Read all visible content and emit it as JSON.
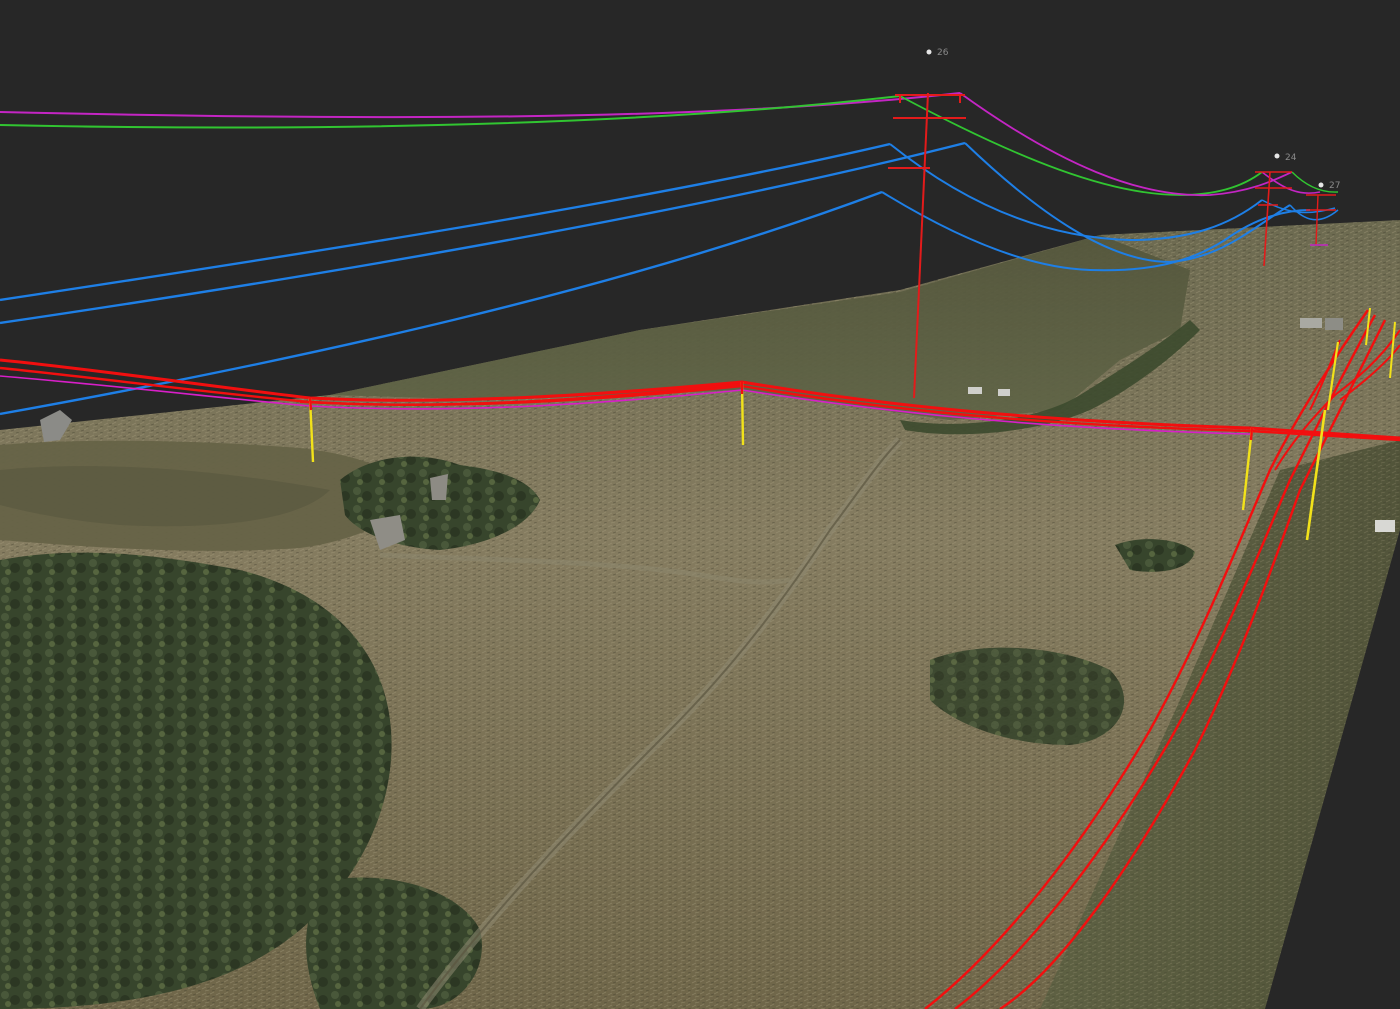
{
  "viewport": {
    "background_color": "#272727",
    "terrain_colors": {
      "grass_light": "#8d8466",
      "grass_mid": "#6f6a50",
      "grass_dark": "#4f4d38",
      "vegetation_dark": "#2f3a24",
      "paddock_green": "#5a5c40"
    }
  },
  "wire_colors": {
    "transmission_upper": "#c425c4",
    "transmission_green": "#31c531",
    "transmission_blue": "#1e7fe6",
    "distribution": "#f20f0f",
    "pole": "#f2e21a",
    "tower": "#e31b1b"
  },
  "towers": [
    {
      "id": "tower-near",
      "label": "26"
    },
    {
      "id": "tower-mid",
      "label": "24"
    },
    {
      "id": "tower-far",
      "label": "27"
    }
  ]
}
